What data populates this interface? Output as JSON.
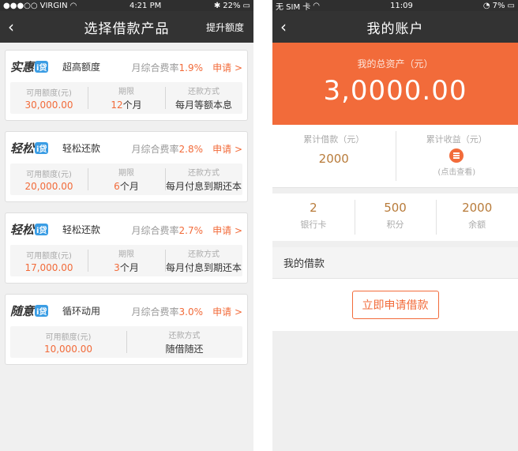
{
  "left": {
    "status": {
      "carrier": "VIRGIN",
      "time": "4:21 PM",
      "battery": "22%"
    },
    "nav": {
      "title": "选择借款产品",
      "right": "提升额度"
    },
    "products": [
      {
        "logo": "实惠",
        "logo_i": "i贷",
        "name": "超高额度",
        "rate_label": "月综合费率",
        "rate": "1.9%",
        "apply": "申请 >",
        "labels": [
          "可用额度(元)",
          "期限",
          "还款方式"
        ],
        "amount": "30,000.00",
        "term_num": "12",
        "term_unit": "个月",
        "method": "每月等额本息"
      },
      {
        "logo": "轻松",
        "logo_i": "i贷",
        "name": "轻松还款",
        "rate_label": "月综合费率",
        "rate": "2.8%",
        "apply": "申请 >",
        "labels": [
          "可用额度(元)",
          "期限",
          "还款方式"
        ],
        "amount": "20,000.00",
        "term_num": "6",
        "term_unit": "个月",
        "method": "每月付息到期还本"
      },
      {
        "logo": "轻松",
        "logo_i": "i贷",
        "name": "轻松还款",
        "rate_label": "月综合费率",
        "rate": "2.7%",
        "apply": "申请 >",
        "labels": [
          "可用额度(元)",
          "期限",
          "还款方式"
        ],
        "amount": "17,000.00",
        "term_num": "3",
        "term_unit": "个月",
        "method": "每月付息到期还本"
      },
      {
        "logo": "随意",
        "logo_i": "i贷",
        "name": "循环动用",
        "rate_label": "月综合费率",
        "rate": "3.0%",
        "apply": "申请 >",
        "labels": [
          "可用额度(元)",
          "还款方式"
        ],
        "amount": "10,000.00",
        "method": "随借随还"
      }
    ]
  },
  "right": {
    "status": {
      "carrier": "无 SIM 卡",
      "time": "11:09",
      "battery": "7%"
    },
    "nav": {
      "title": "我的账户"
    },
    "hero": {
      "label": "我的总资产（元）",
      "amount": "3,0000.00"
    },
    "borrow": {
      "label": "累计借款（元）",
      "value": "2000"
    },
    "income": {
      "label": "累计收益（元）",
      "hint": "(点击查看)"
    },
    "stats": [
      {
        "value": "2",
        "label": "银行卡"
      },
      {
        "value": "500",
        "label": "积分"
      },
      {
        "value": "2000",
        "label": "余额"
      }
    ],
    "section_title": "我的借款",
    "apply_button": "立即申请借款"
  },
  "colors": {
    "accent": "#f26b3a",
    "nav_bg": "#333333",
    "gold": "#b87b3a",
    "logo_blue": "#3b9de4"
  }
}
